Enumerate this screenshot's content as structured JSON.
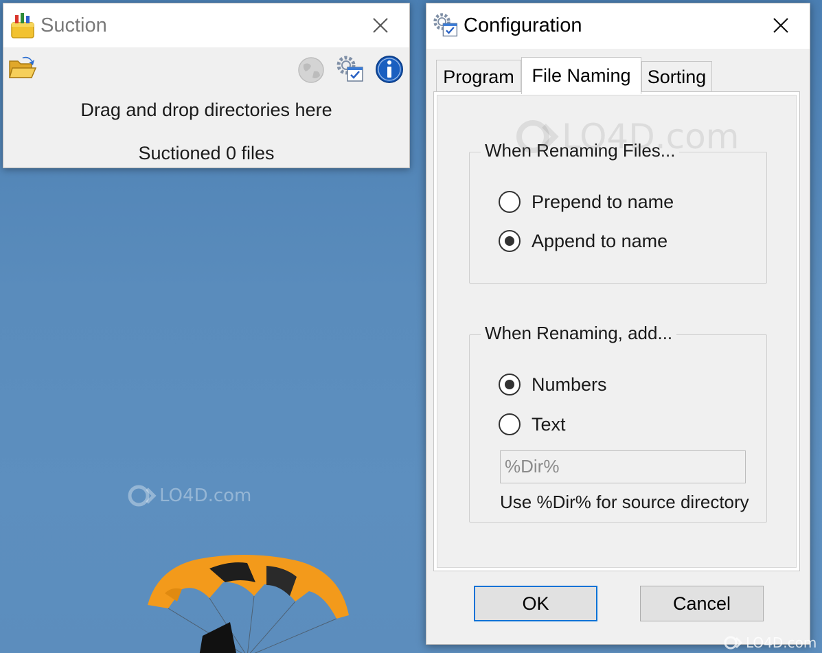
{
  "suction": {
    "title": "Suction",
    "drop_message": "Drag and drop directories here",
    "status": "Suctioned 0 files",
    "toolbar": {
      "icons": [
        "open-folder-icon",
        "globe-icon",
        "configuration-icon",
        "info-icon"
      ]
    }
  },
  "config": {
    "title": "Configuration",
    "tabs": [
      {
        "label": "Program",
        "active": false
      },
      {
        "label": "File Naming",
        "active": true
      },
      {
        "label": "Sorting",
        "active": false
      }
    ],
    "renaming_group": {
      "label": "When Renaming Files...",
      "options": [
        {
          "label": "Prepend to name",
          "checked": false
        },
        {
          "label": "Append to name",
          "checked": true
        }
      ]
    },
    "add_group": {
      "label": "When Renaming, add...",
      "options": [
        {
          "label": "Numbers",
          "checked": true
        },
        {
          "label": "Text",
          "checked": false
        }
      ],
      "text_value": "%Dir%",
      "hint": "Use %Dir% for source directory"
    },
    "ok_label": "OK",
    "cancel_label": "Cancel"
  },
  "watermark": {
    "text": "LO4D.com"
  },
  "colors": {
    "desktop": "#5a8cbc",
    "window_bg": "#f0f0f0",
    "default_button_border": "#0a72d6",
    "info_blue": "#1a5fc0"
  }
}
